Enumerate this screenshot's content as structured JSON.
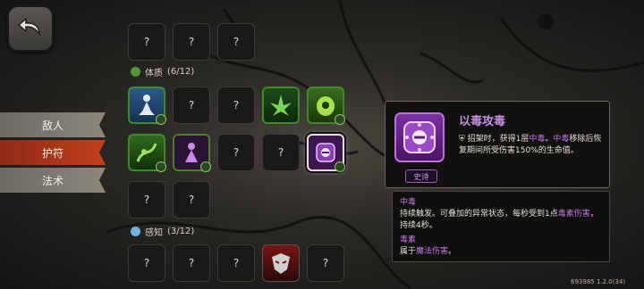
{
  "tabs": [
    {
      "label": "敌人",
      "active": false
    },
    {
      "label": "护符",
      "active": true
    },
    {
      "label": "法术",
      "active": false
    }
  ],
  "sections": {
    "constitution": {
      "label": "体质",
      "progress": "(6/12)",
      "icon_color": "#4f9a34"
    },
    "perception": {
      "label": "感知",
      "progress": "(3/12)",
      "icon_color": "#6fb3e0"
    }
  },
  "slots": {
    "unknown": "?"
  },
  "detail": {
    "title": "以毒攻毒",
    "desc_prefix": "招架时，获得1层",
    "kw_poison_1": "中毒",
    "desc_mid": "。",
    "kw_poison_2": "中毒",
    "desc_suffix": "移除后恢复期间所受伤害150%的生命值。",
    "rarity": "史诗"
  },
  "glossary": {
    "poison_title": "中毒",
    "poison_desc_a": "持续触发。可叠加的异常状态，每秒受到1点",
    "poison_kw": "毒素伤害",
    "poison_desc_b": "，持续4秒。",
    "toxin_title": "毒素",
    "toxin_desc_a": "属于",
    "toxin_kw": "魔法伤害",
    "toxin_desc_b": "。"
  },
  "version": "693985 1.2.0(34)",
  "colors": {
    "accent_purple": "#c778e6",
    "active_tab": "#c2401c",
    "green_frame": "#3f8a2a"
  }
}
